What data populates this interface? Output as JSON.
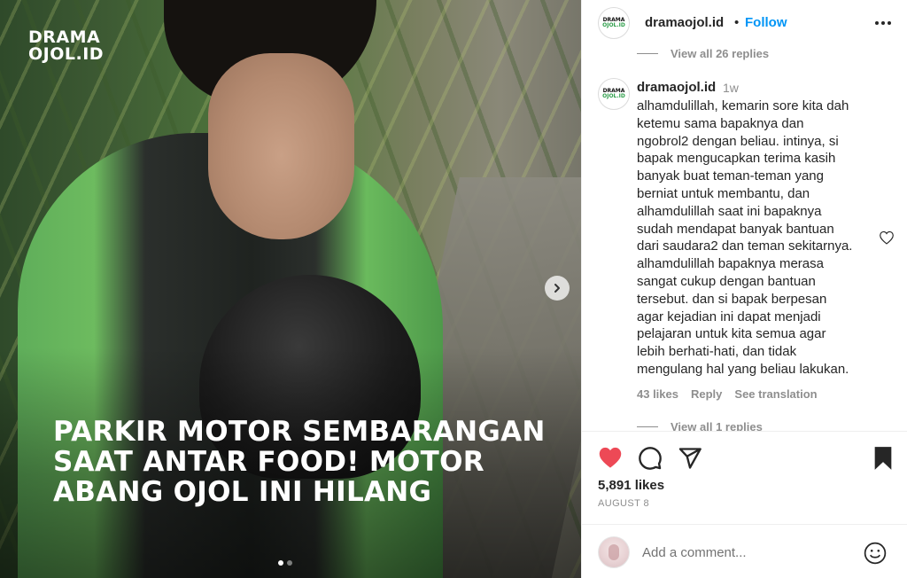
{
  "media": {
    "logo_line1": "DRAMA",
    "logo_line2": "OJOL.ID",
    "headline": [
      "PARKIR MOTOR SEMBARANGAN",
      "SAAT ANTAR FOOD! MOTOR",
      "ABANG OJOL INI HILANG"
    ],
    "next_icon": "chevron-right-icon",
    "carousel": {
      "total": 2,
      "current": 1
    }
  },
  "header": {
    "avatar_line1": "DRAMA",
    "avatar_line2": "OJOL.ID",
    "username": "dramaojol.id",
    "separator": "•",
    "follow_label": "Follow",
    "more_icon": "more-horizontal-icon"
  },
  "comments": {
    "view_replies_top": "View all 26 replies",
    "comment": {
      "avatar_line1": "DRAMA",
      "avatar_line2": "OJOL.ID",
      "username": "dramaojol.id",
      "time": "1w",
      "lines": [
        "alhamdulillah, kemarin sore kita dah",
        "ketemu sama bapaknya dan",
        "ngobrol2 dengan beliau. intinya, si",
        "bapak mengucapkan terima kasih",
        "banyak buat teman-teman yang",
        "berniat untuk membantu, dan",
        "alhamdulillah saat ini bapaknya",
        "sudah mendapat banyak bantuan",
        "dari saudara2 dan teman sekitarnya.",
        "alhamdulillah bapaknya merasa",
        "sangat cukup dengan bantuan",
        "tersebut. dan si bapak berpesan",
        "agar kejadian ini dapat menjadi",
        "pelajaran untuk kita semua agar",
        "lebih berhati-hati, dan tidak",
        "mengulang hal yang beliau lakukan."
      ],
      "likes": "43 likes",
      "reply_label": "Reply",
      "translate_label": "See translation",
      "like_icon": "heart-outline-icon"
    },
    "view_replies_bottom": "View all 1 replies"
  },
  "actions": {
    "like_icon": "heart-filled-icon",
    "comment_icon": "comment-icon",
    "share_icon": "send-icon",
    "save_icon": "bookmark-filled-icon",
    "likes_count": "5,891 likes",
    "date": "AUGUST 8",
    "like_color": "#ed4956"
  },
  "add_comment": {
    "placeholder": "Add a comment...",
    "emoji_icon": "emoji-icon"
  },
  "colors": {
    "accent": "#0095f6",
    "muted": "#8e8e8e",
    "text": "#262626"
  }
}
